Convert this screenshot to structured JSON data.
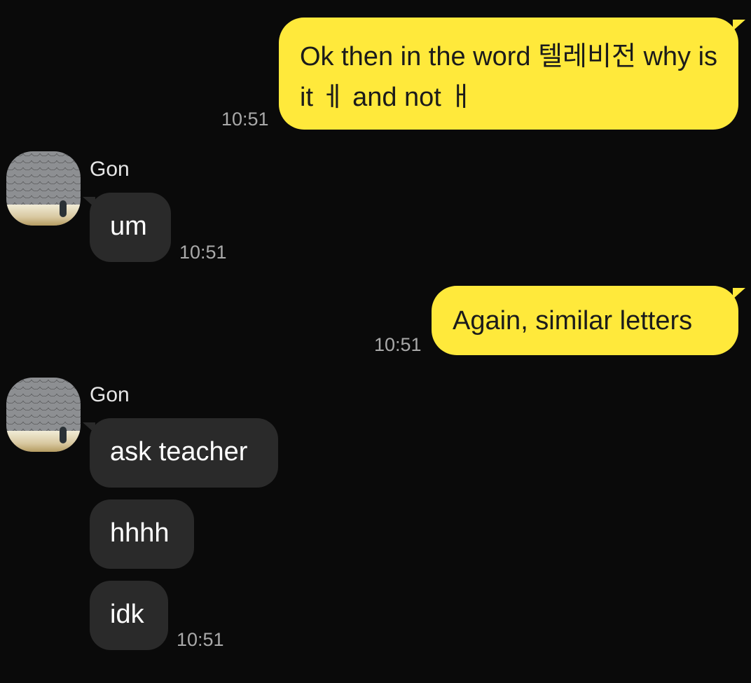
{
  "messages": [
    {
      "type": "sent",
      "text": "Ok then in the word 텔레비전 why is it ㅔ and not ㅐ",
      "time": "10:51"
    },
    {
      "type": "received",
      "sender": "Gon",
      "text": "um",
      "time": "10:51"
    },
    {
      "type": "sent",
      "text": "Again, similar letters",
      "time": "10:51"
    },
    {
      "type": "received",
      "sender": "Gon",
      "text": "ask teacher"
    },
    {
      "type": "received",
      "text": "hhhh"
    },
    {
      "type": "received",
      "text": "idk",
      "time": "10:51"
    }
  ],
  "colors": {
    "background": "#0a0a0a",
    "sent_bubble": "#ffe93b",
    "received_bubble": "#2a2a2a",
    "timestamp": "#a9a9a9"
  },
  "icons": {
    "avatar": "profile-photo-icon"
  }
}
